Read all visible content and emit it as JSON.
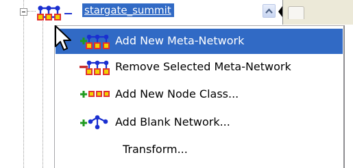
{
  "tree": {
    "node": {
      "label": "stargate_summit",
      "icon": "meta-network-icon",
      "state": "expanded"
    }
  },
  "context_menu": {
    "items": [
      {
        "label": "Add New Meta-Network",
        "icon": "add-meta-network-icon",
        "highlighted": true
      },
      {
        "label": "Remove Selected Meta-Network",
        "icon": "remove-meta-network-icon",
        "highlighted": false
      },
      {
        "label": "Add New Node Class...",
        "icon": "add-node-class-icon",
        "highlighted": false
      },
      {
        "label": "Add Blank Network...",
        "icon": "add-blank-network-icon",
        "highlighted": false
      },
      {
        "label": "Transform...",
        "icon": "",
        "highlighted": false
      }
    ]
  },
  "colors": {
    "selection": "#316ac5",
    "node_blue": "#1a2fd0",
    "node_red": "#e03030",
    "node_yellow": "#f2d200",
    "plus_green": "#1f9a1f",
    "minus_red": "#c01818"
  }
}
